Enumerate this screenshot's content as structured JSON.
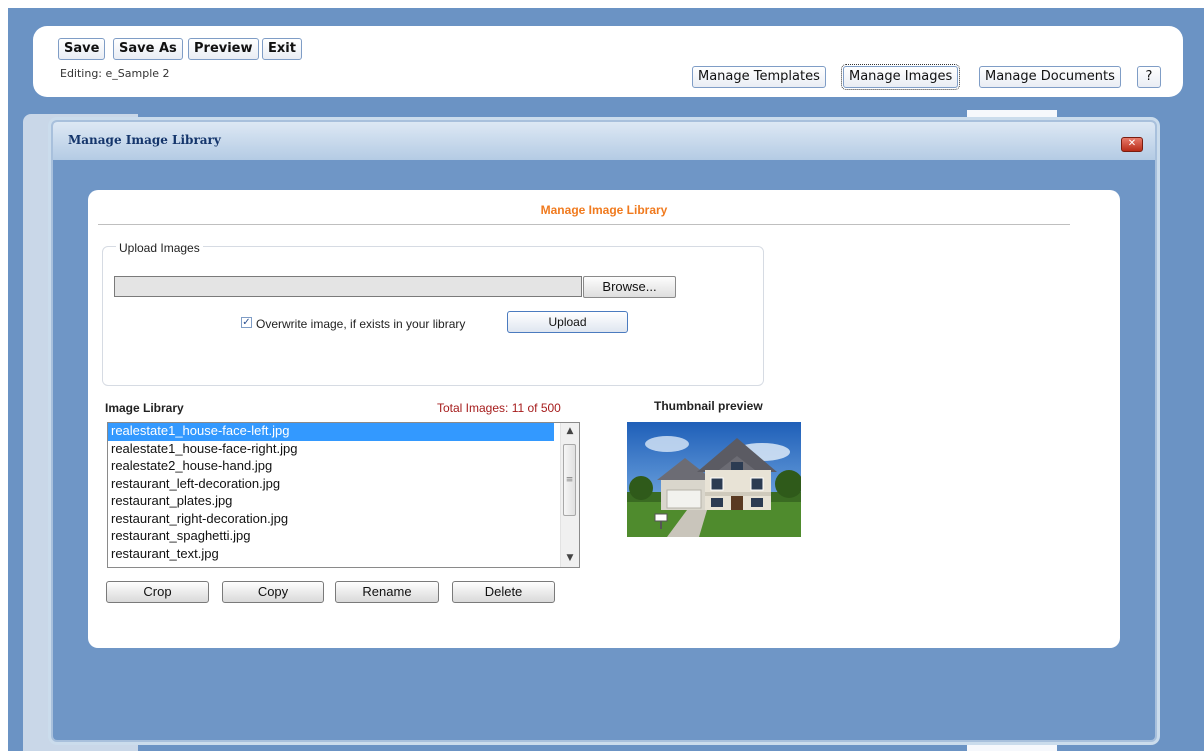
{
  "toolbar": {
    "save": "Save",
    "save_as": "Save As",
    "preview": "Preview",
    "exit": "Exit",
    "editing": "Editing: e_Sample 2",
    "manage_templates": "Manage Templates",
    "manage_images": "Manage Images",
    "manage_documents": "Manage Documents",
    "help": "?"
  },
  "dialog": {
    "title": "Manage Image Library",
    "close_icon": "close-x-icon"
  },
  "panel": {
    "heading": "Manage Image Library",
    "upload_legend": "Upload Images",
    "browse": "Browse...",
    "overwrite_checked": true,
    "overwrite_label": "Overwrite image, if exists in your library",
    "upload": "Upload",
    "library_label": "Image Library",
    "total": "Total Images: 11 of 500",
    "thumbnail_label": "Thumbnail preview",
    "images": [
      "realestate1_house-face-left.jpg",
      "realestate1_house-face-right.jpg",
      "realestate2_house-hand.jpg",
      "restaurant_left-decoration.jpg",
      "restaurant_plates.jpg",
      "restaurant_right-decoration.jpg",
      "restaurant_spaghetti.jpg",
      "restaurant_text.jpg"
    ],
    "selected_image": "realestate1_house-face-left.jpg",
    "actions": {
      "crop": "Crop",
      "copy": "Copy",
      "rename": "Rename",
      "delete": "Delete"
    }
  },
  "colors": {
    "heading_accent": "#f07a1e",
    "total_text": "#a61c1c",
    "selection": "#3399ff",
    "frame_blue": "#6b93c4"
  }
}
